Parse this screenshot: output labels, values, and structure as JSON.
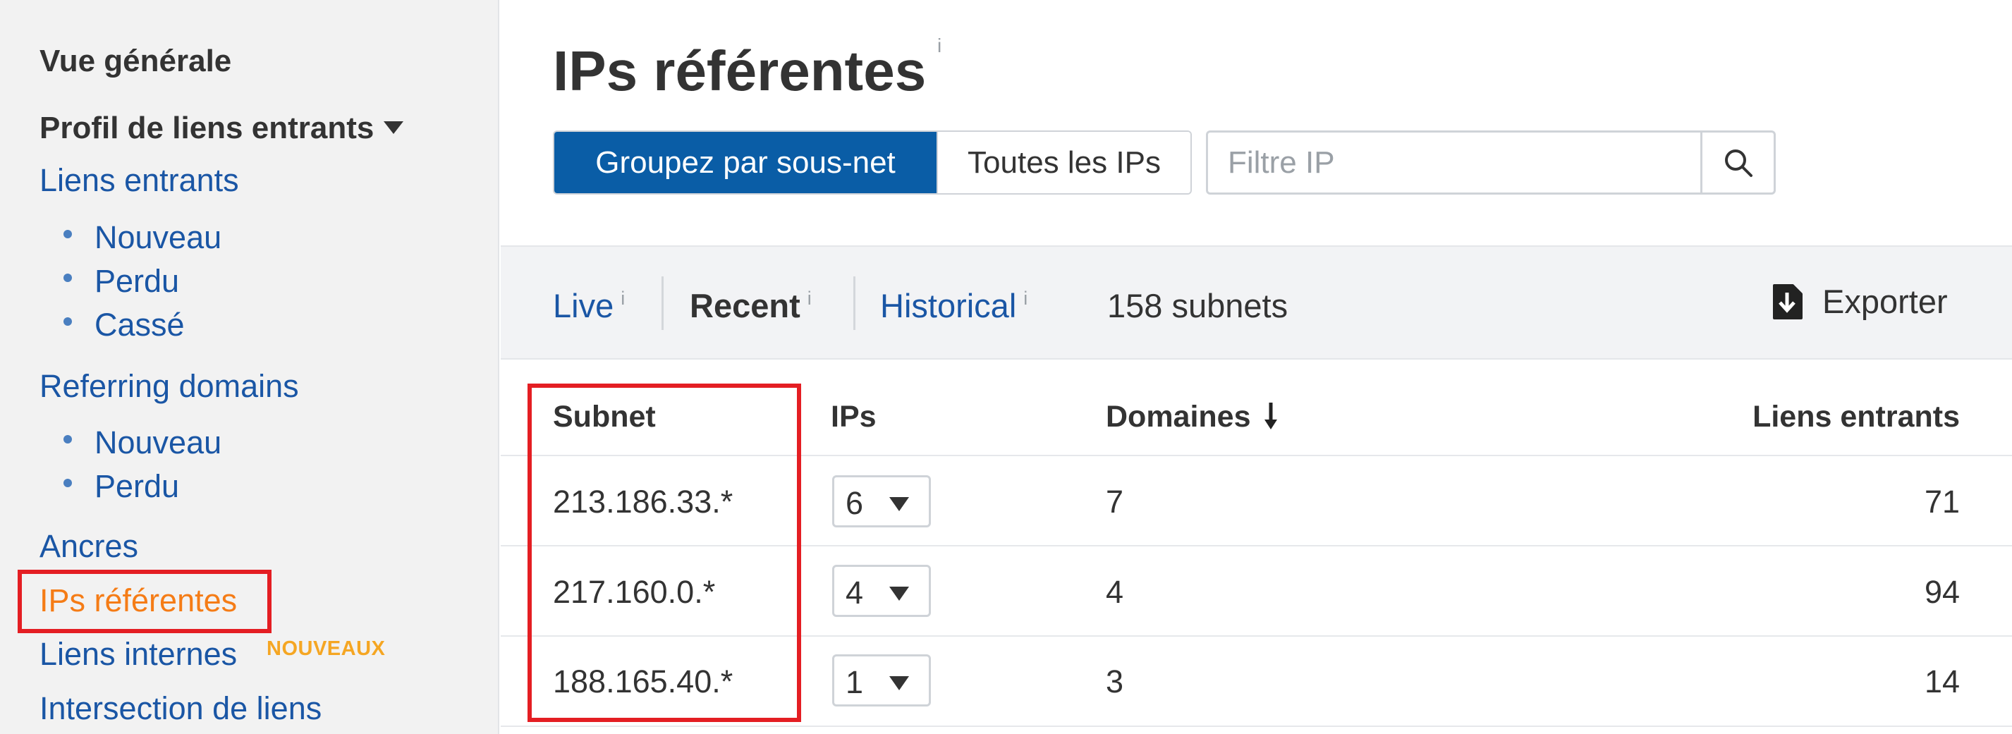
{
  "sidebar": {
    "overview": "Vue générale",
    "backlink_profile": "Profil de liens entrants",
    "backlinks": "Liens entrants",
    "backlinks_sub": [
      "Nouveau",
      "Perdu",
      "Cassé"
    ],
    "referring_domains": "Referring domains",
    "referring_domains_sub": [
      "Nouveau",
      "Perdu"
    ],
    "anchors": "Ancres",
    "referring_ips": "IPs référentes",
    "internal_links": "Liens internes",
    "internal_links_badge": "NOUVEAUX",
    "link_intersect": "Intersection de liens"
  },
  "main": {
    "title": "IPs référentes",
    "info_mark": "i",
    "group_by_subnet": "Groupez par sous-net",
    "all_ips": "Toutes les IPs",
    "filter_placeholder": "Filtre IP",
    "modes": {
      "live": "Live",
      "recent": "Recent",
      "historical": "Historical"
    },
    "subnet_count": "158 subnets",
    "export": "Exporter",
    "columns": {
      "subnet": "Subnet",
      "ips": "IPs",
      "domains": "Domaines",
      "backlinks": "Liens entrants"
    },
    "rows": [
      {
        "subnet": "213.186.33.*",
        "ips": "6",
        "domains": "7",
        "backlinks": "71"
      },
      {
        "subnet": "217.160.0.*",
        "ips": "4",
        "domains": "4",
        "backlinks": "94"
      },
      {
        "subnet": "188.165.40.*",
        "ips": "1",
        "domains": "3",
        "backlinks": "14"
      }
    ]
  },
  "colors": {
    "primary_button": "#0a5da6",
    "link": "#1a56a5",
    "active_nav": "#f57c16",
    "highlight_box": "#e41e23",
    "badge": "#f5a623"
  }
}
